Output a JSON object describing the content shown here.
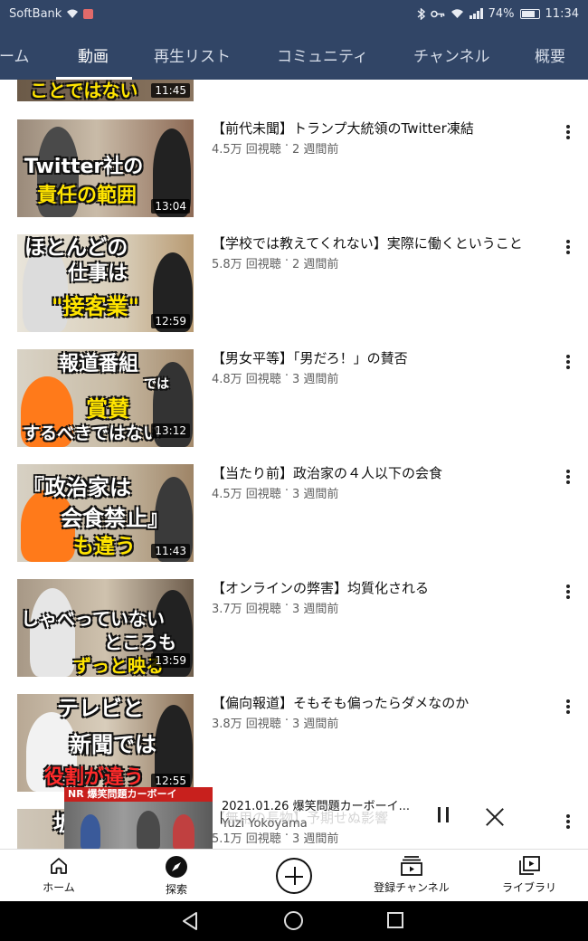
{
  "status_bar": {
    "carrier": "SoftBank",
    "battery": "74%",
    "time": "11:34"
  },
  "tabs": [
    {
      "label": "ホーム"
    },
    {
      "label": "動画",
      "active": true
    },
    {
      "label": "再生リスト"
    },
    {
      "label": "コミュニティ"
    },
    {
      "label": "チャンネル"
    },
    {
      "label": "概要"
    }
  ],
  "videos": [
    {
      "title": "",
      "views": "",
      "age": "",
      "duration": "11:45",
      "thumb_text": [
        "ことではない"
      ]
    },
    {
      "title": "【前代未聞】トランプ大統領のTwitter凍結",
      "views": "4.5万 回視聴",
      "age": "2 週間前",
      "duration": "13:04",
      "thumb_text": [
        "Twitter社の",
        "責任の範囲"
      ]
    },
    {
      "title": "【学校では教えてくれない】実際に働くということ",
      "views": "5.8万 回視聴",
      "age": "2 週間前",
      "duration": "12:59",
      "thumb_text": [
        "ほとんどの",
        "仕事は",
        "\"接客業\""
      ]
    },
    {
      "title": "【男女平等】「男だろ！」の賛否",
      "views": "4.8万 回視聴",
      "age": "3 週間前",
      "duration": "13:12",
      "thumb_text": [
        "報道番組",
        "では",
        "賞賛",
        "するべきではない"
      ]
    },
    {
      "title": "【当たり前】政治家の４人以下の会食",
      "views": "4.5万 回視聴",
      "age": "3 週間前",
      "duration": "11:43",
      "thumb_text": [
        "『政治家は",
        "会食禁止』",
        "も違う"
      ]
    },
    {
      "title": "【オンラインの弊害】均質化される",
      "views": "3.7万 回視聴",
      "age": "3 週間前",
      "duration": "13:59",
      "thumb_text": [
        "しゃべっていない",
        "ところも",
        "ずっと映る"
      ]
    },
    {
      "title": "【偏向報道】そもそも偏ったらダメなのか",
      "views": "3.8万 回視聴",
      "age": "3 週間前",
      "duration": "12:55",
      "thumb_text": [
        "テレビと",
        "新聞では",
        "役割が違う"
      ]
    },
    {
      "title": "【無用の長物】予期せぬ影響",
      "views": "5.1万 回視聴",
      "age": "3 週間前",
      "duration": "",
      "thumb_text": [
        "坂"
      ]
    }
  ],
  "mini_player": {
    "title": "2021.01.26 爆笑問題カーボーイ...",
    "channel": "Yuzi Yokoyama",
    "thumb_banner": "NR 爆笑問題カーボーイ"
  },
  "bottom_nav": [
    {
      "label": "ホーム",
      "icon": "home-icon"
    },
    {
      "label": "探索",
      "icon": "compass-icon"
    },
    {
      "label": "",
      "icon": "add-icon"
    },
    {
      "label": "登録チャンネル",
      "icon": "subscriptions-icon"
    },
    {
      "label": "ライブラリ",
      "icon": "library-icon"
    }
  ],
  "colors": {
    "header_bg": "#314566",
    "caption_yellow": "#ffe400",
    "caption_red": "#ff2a2a"
  }
}
